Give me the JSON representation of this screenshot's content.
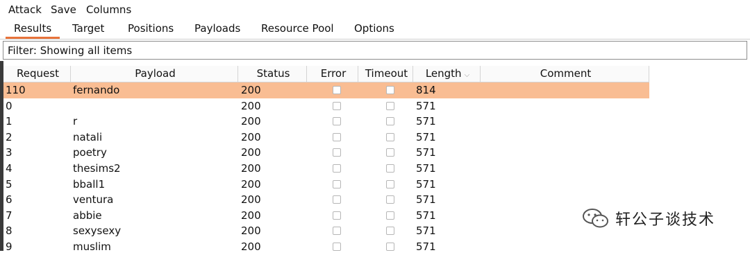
{
  "menu": {
    "items": [
      "Attack",
      "Save",
      "Columns"
    ]
  },
  "tabs": [
    "Results",
    "Target",
    "Positions",
    "Payloads",
    "Resource Pool",
    "Options"
  ],
  "filter": {
    "text": "Filter: Showing all items"
  },
  "table": {
    "headers": {
      "request": "Request",
      "payload": "Payload",
      "status": "Status",
      "error": "Error",
      "timeout": "Timeout",
      "length": "Length",
      "comment": "Comment"
    },
    "length_sort_icon": "chevron-down-icon",
    "rows": [
      {
        "request": "110",
        "payload": "fernando",
        "status": "200",
        "length": "814",
        "comment": "",
        "selected": true
      },
      {
        "request": "0",
        "payload": "",
        "status": "200",
        "length": "571",
        "comment": ""
      },
      {
        "request": "1",
        "payload": "r",
        "status": "200",
        "length": "571",
        "comment": ""
      },
      {
        "request": "2",
        "payload": "natali",
        "status": "200",
        "length": "571",
        "comment": ""
      },
      {
        "request": "3",
        "payload": "poetry",
        "status": "200",
        "length": "571",
        "comment": ""
      },
      {
        "request": "4",
        "payload": "thesims2",
        "status": "200",
        "length": "571",
        "comment": ""
      },
      {
        "request": "5",
        "payload": "bball1",
        "status": "200",
        "length": "571",
        "comment": ""
      },
      {
        "request": "6",
        "payload": "ventura",
        "status": "200",
        "length": "571",
        "comment": ""
      },
      {
        "request": "7",
        "payload": "abbie",
        "status": "200",
        "length": "571",
        "comment": ""
      },
      {
        "request": "8",
        "payload": "sexysexy",
        "status": "200",
        "length": "571",
        "comment": ""
      },
      {
        "request": "9",
        "payload": "muslim",
        "status": "200",
        "length": "571",
        "comment": ""
      }
    ]
  },
  "watermark": {
    "text": "轩公子谈技术",
    "icon": "wechat-icon"
  },
  "colors": {
    "accent": "#e8733a",
    "selected_row": "#f9bd93"
  }
}
